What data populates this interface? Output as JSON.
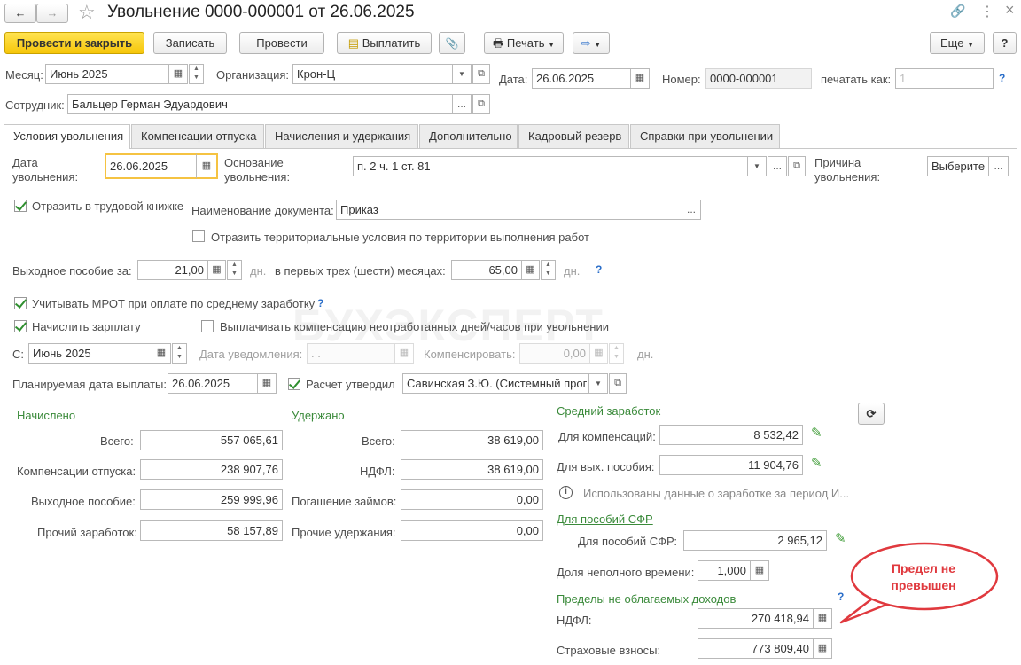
{
  "title_bar": {
    "title": "Увольнение 0000-000001 от 26.06.2025",
    "back": "←",
    "forward": "→",
    "star": "☆",
    "link": "🔗",
    "menu": "⋮",
    "min": "–",
    "close": "×"
  },
  "toolbar": {
    "post_close": "Провести и закрыть",
    "save": "Записать",
    "post": "Провести",
    "pay": "Выплатить",
    "attach": "📎",
    "print": "Печать",
    "more": "Еще",
    "help": "?"
  },
  "header": {
    "month_label": "Месяц:",
    "month_value": "Июнь 2025",
    "org_label": "Организация:",
    "org_value": "Крон-Ц",
    "date_label": "Дата:",
    "date_value": "26.06.2025",
    "number_label": "Номер:",
    "number_value": "0000-000001",
    "print_as_label": "печатать как:",
    "print_as_placeholder": "1",
    "employee_label": "Сотрудник:",
    "employee_value": "Бальцер Герман Эдуардович"
  },
  "tabs": [
    {
      "label": "Условия увольнения"
    },
    {
      "label": "Компенсации отпуска"
    },
    {
      "label": "Начисления и удержания"
    },
    {
      "label": "Дополнительно"
    },
    {
      "label": "Кадровый резерв"
    },
    {
      "label": "Справки при увольнении"
    }
  ],
  "conditions": {
    "dismissal_date_label": "Дата\nувольнения:",
    "dismissal_date_value": "26.06.2025",
    "basis_label": "Основание\nувольнения:",
    "basis_value": "п. 2 ч. 1 ст. 81",
    "reason_label": "Причина\nувольнения:",
    "reason_button": "Выберите",
    "workbook_label": "Отразить в трудовой книжке",
    "doc_name_label": "Наименование документа:",
    "doc_name_value": "Приказ",
    "territorial_label": "Отразить территориальные условия по территории выполнения работ",
    "severance_label": "Выходное пособие за:",
    "severance_days": "21,00",
    "days_unit": "дн.",
    "first_months_label": "в первых трех (шести) месяцах:",
    "first_months_value": "65,00",
    "days_unit2": "дн.",
    "mrot_label": "Учитывать МРОТ при оплате по среднему заработку",
    "salary_label": "Начислить зарплату",
    "comp_unworked_label": "Выплачивать компенсацию неотработанных дней/часов при увольнении",
    "from_label": "С:",
    "from_value": "Июнь 2025",
    "notice_date_label": "Дата уведомления:",
    "notice_date_value": ". .",
    "compensate_label": "Компенсировать:",
    "compensate_value": "0,00",
    "days_unit3": "дн.",
    "planned_pay_label": "Планируемая дата выплаты:",
    "planned_pay_value": "26.06.2025",
    "calc_approved_label": "Расчет утвердил",
    "approver_value": "Савинская З.Ю. (Системный прог"
  },
  "accrued": {
    "heading": "Начислено",
    "total_label": "Всего:",
    "total_value": "557 065,61",
    "vacation_label": "Компенсации отпуска:",
    "vacation_value": "238 907,76",
    "severance_label": "Выходное пособие:",
    "severance_value": "259 999,96",
    "other_label": "Прочий заработок:",
    "other_value": "58 157,89"
  },
  "withheld": {
    "heading": "Удержано",
    "total_label": "Всего:",
    "total_value": "38 619,00",
    "ndfl_label": "НДФЛ:",
    "ndfl_value": "38 619,00",
    "loans_label": "Погашение займов:",
    "loans_value": "0,00",
    "other_label": "Прочие удержания:",
    "other_value": "0,00"
  },
  "average": {
    "heading": "Средний заработок",
    "comp_label": "Для компенсаций:",
    "comp_value": "8 532,42",
    "sev_label": "Для вых. пособия:",
    "sev_value": "11 904,76",
    "info_text": "Использованы данные о заработке за период И...",
    "sfr_link": "Для пособий СФР",
    "sfr_label": "Для пособий СФР:",
    "sfr_value": "2 965,12",
    "part_time_label": "Доля неполного времени:",
    "part_time_value": "1,000",
    "limits_heading": "Пределы не облагаемых доходов",
    "ndfl_label": "НДФЛ:",
    "ndfl_value": "270 418,94",
    "insurance_label": "Страховые взносы:",
    "insurance_value": "773 809,40"
  },
  "callout": {
    "text": "Предел не превышен",
    "color": "#e0393e"
  },
  "watermark": "БУХЭКСПЕРТ"
}
